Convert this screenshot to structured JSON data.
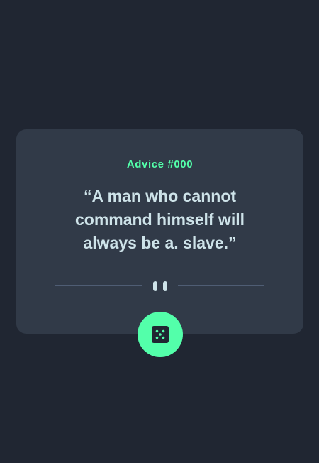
{
  "card": {
    "advice_label": "Advice #000",
    "quote": "“A man who cannot command himself will always be a. slave.”"
  },
  "icons": {
    "divider": "pause-icon",
    "button": "dice-icon"
  },
  "colors": {
    "background": "#202632",
    "card": "#313A48",
    "accent": "#53FFAA",
    "text": "#CEE3E9",
    "divider": "#4F5D74"
  }
}
